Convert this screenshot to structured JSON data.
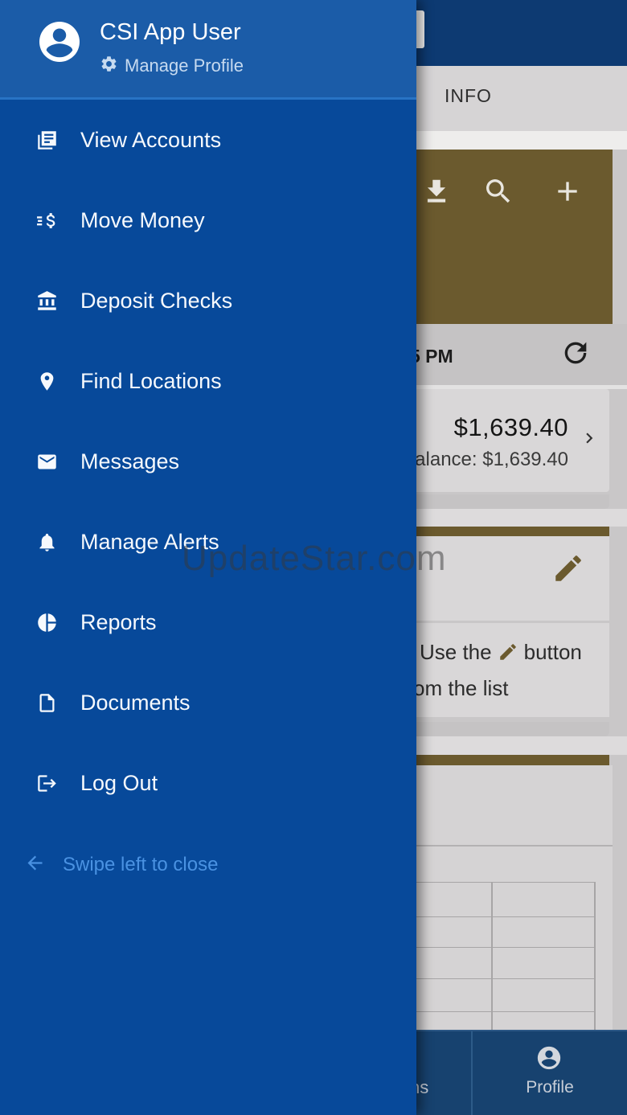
{
  "drawer": {
    "user_name": "CSI App User",
    "manage_profile_label": "Manage Profile",
    "menu_items": [
      {
        "label": "View Accounts",
        "icon": "accounts-stack-icon"
      },
      {
        "label": "Move Money",
        "icon": "move-money-icon"
      },
      {
        "label": "Deposit Checks",
        "icon": "bank-icon"
      },
      {
        "label": "Find Locations",
        "icon": "location-pin-icon"
      },
      {
        "label": "Messages",
        "icon": "envelope-icon"
      },
      {
        "label": "Manage Alerts",
        "icon": "bell-icon"
      },
      {
        "label": "Reports",
        "icon": "pie-chart-icon"
      },
      {
        "label": "Documents",
        "icon": "document-icon"
      },
      {
        "label": "Log Out",
        "icon": "logout-icon"
      }
    ],
    "swipe_hint": "Swipe left to close"
  },
  "main": {
    "tab_label": "INFO",
    "status_row": {
      "time_fragment": "5 PM"
    },
    "account_card": {
      "amount": "$1,639.40",
      "balance_line_fragment": "alance: $1,639.40"
    },
    "instructions": {
      "line1_prefix": "Use the",
      "line1_suffix": "button",
      "line2_fragment": "om the list"
    }
  },
  "bottom_nav": {
    "left_tab_fragment": "ns",
    "profile_label": "Profile"
  },
  "watermark": "UpdateStar.com",
  "colors": {
    "drawer_header_blue": "#1b5ca8",
    "drawer_body_blue": "#07499a",
    "topbar_navy": "#0d3a72",
    "gold": "#6b5a2e",
    "bottom_nav_navy": "#17426f",
    "link_blue": "#4a92e2"
  }
}
